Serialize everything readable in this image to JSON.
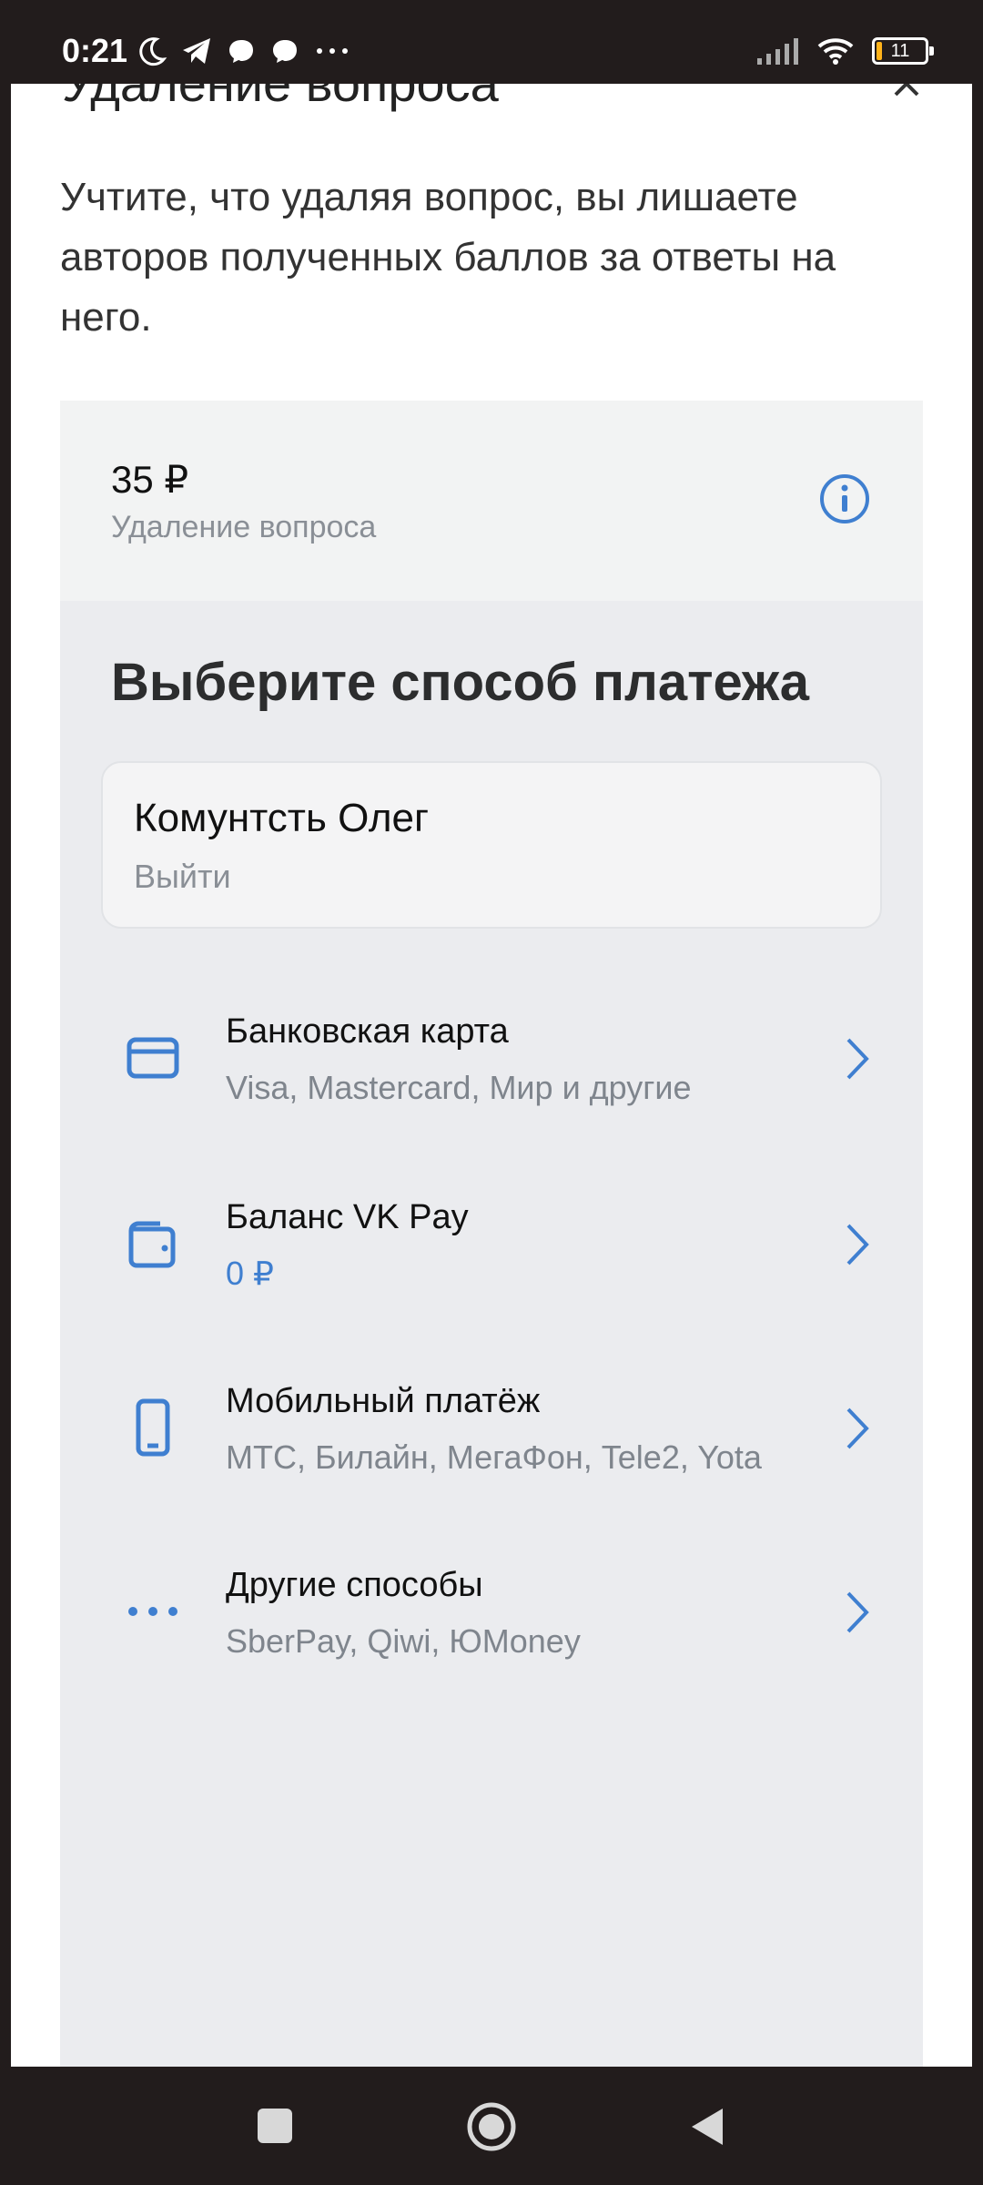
{
  "status_bar": {
    "time": "0:21",
    "battery": "11",
    "icons": [
      "moon-icon",
      "telegram-icon",
      "chat-bubble-icon",
      "chat-bubble-icon",
      "more-dots-icon",
      "signal-icon",
      "wifi-icon",
      "battery-icon"
    ],
    "battery_fill_percent": 11
  },
  "sheet": {
    "title": "Удаление вопроса",
    "warning": "Учтите, что удаляя вопрос, вы лишаете авторов полученных баллов за ответы на него."
  },
  "price": {
    "amount": "35 ₽",
    "description": "Удаление вопроса"
  },
  "payment": {
    "title": "Выберите способ платежа",
    "user": {
      "name": "Комунтсть Олег",
      "logout": "Выйти"
    },
    "methods": [
      {
        "title": "Банковская карта",
        "subtitle": "Visa, Mastercard, Мир и другие",
        "icon": "credit-card-icon"
      },
      {
        "title": "Баланс VK Pay",
        "subtitle": "0 ₽",
        "icon": "wallet-icon"
      },
      {
        "title": "Мобильный платёж",
        "subtitle": "МТС, Билайн, МегаФон, Tele2, Yota",
        "icon": "mobile-phone-icon"
      },
      {
        "title": "Другие способы",
        "subtitle": "SberPay, Qiwi, ЮMoney",
        "icon": "more-dots-icon"
      }
    ]
  },
  "colors": {
    "accent": "#3f7fd0",
    "system_bar": "#221c1c",
    "panel": "#ebecef"
  }
}
